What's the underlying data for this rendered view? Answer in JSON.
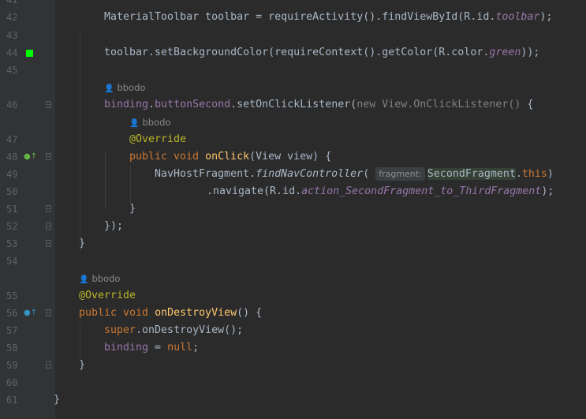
{
  "editor": {
    "lines": [
      {
        "num": "41"
      },
      {
        "num": "42",
        "code": [
          {
            "t": "MaterialToolbar toolbar = requireActivity().findViewById(R.id."
          },
          {
            "t": "toolbar",
            "c": "field"
          },
          {
            "t": ");"
          }
        ]
      },
      {
        "num": "43"
      },
      {
        "num": "44",
        "code": [
          {
            "t": "toolbar.setBackgroundColor(requireContext().getColor(R.color."
          },
          {
            "t": "green",
            "c": "field"
          },
          {
            "t": "));"
          }
        ]
      },
      {
        "num": "45"
      },
      {
        "author": "bbodo"
      },
      {
        "num": "46",
        "code": [
          {
            "t": "binding",
            "c": "field-plain"
          },
          {
            "t": "."
          },
          {
            "t": "buttonSecond",
            "c": "field-plain"
          },
          {
            "t": ".setOnClickListener("
          },
          {
            "t": "new View.OnClickListener() ",
            "c": "dim"
          },
          {
            "t": "{"
          }
        ]
      },
      {
        "author": "bbodo"
      },
      {
        "num": "47",
        "code": [
          {
            "t": "@Override",
            "c": "ann"
          }
        ]
      },
      {
        "num": "48",
        "code": [
          {
            "t": "public void ",
            "c": "kw"
          },
          {
            "t": "onClick",
            "c": "fn"
          },
          {
            "t": "(View view) {"
          }
        ]
      },
      {
        "num": "49",
        "code": [
          {
            "t": "NavHostFragment."
          },
          {
            "t": "findNavController",
            "c": "it"
          },
          {
            "t": "( "
          },
          {
            "hint": "fragment:"
          },
          {
            "t": "SecondFragment",
            "c": "hl"
          },
          {
            "t": "."
          },
          {
            "t": "this",
            "c": "kw"
          },
          {
            "t": ")"
          }
        ]
      },
      {
        "num": "50",
        "code": [
          {
            "t": ".navigate(R.id."
          },
          {
            "t": "action_SecondFragment_to_ThirdFragment",
            "c": "field"
          },
          {
            "t": ");"
          }
        ]
      },
      {
        "num": "51",
        "code": [
          {
            "t": "}"
          }
        ]
      },
      {
        "num": "52",
        "code": [
          {
            "t": "});"
          }
        ]
      },
      {
        "num": "53",
        "code": [
          {
            "t": "}"
          }
        ]
      },
      {
        "num": "54"
      },
      {
        "author": "bbodo"
      },
      {
        "num": "55",
        "code": [
          {
            "t": "@Override",
            "c": "ann"
          }
        ]
      },
      {
        "num": "56",
        "code": [
          {
            "t": "public void ",
            "c": "kw"
          },
          {
            "t": "onDestroyView",
            "c": "fn"
          },
          {
            "t": "() {"
          }
        ]
      },
      {
        "num": "57",
        "code": [
          {
            "t": "super",
            "c": "kw"
          },
          {
            "t": ".onDestroyView();"
          }
        ]
      },
      {
        "num": "58",
        "code": [
          {
            "t": "binding",
            "c": "field-plain"
          },
          {
            "t": " = "
          },
          {
            "t": "null",
            "c": "kw"
          },
          {
            "t": ";"
          }
        ]
      },
      {
        "num": "59",
        "code": [
          {
            "t": "}"
          }
        ]
      },
      {
        "num": "60"
      },
      {
        "num": "61",
        "code": [
          {
            "t": "}"
          }
        ]
      }
    ]
  },
  "icons": {
    "color_swatch": "#00ff00",
    "line48_gutter": "implements-icon",
    "line56_gutter": "override-icon"
  }
}
